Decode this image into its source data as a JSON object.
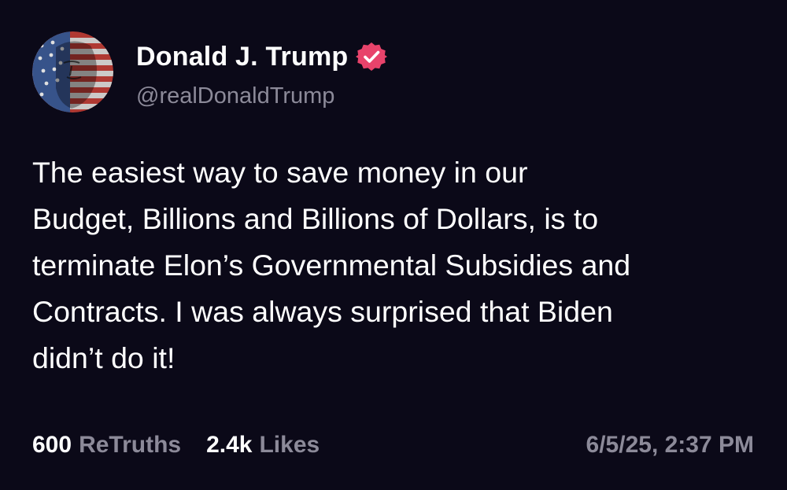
{
  "author": {
    "display_name": "Donald J. Trump",
    "handle": "@realDonaldTrump",
    "verified": true,
    "avatar_icon": "flag-portrait-avatar",
    "badge_color": "#e8436b"
  },
  "post": {
    "lines": [
      "The easiest way to save money in our",
      "Budget, Billions and Billions of Dollars, is to",
      "terminate Elon’s Governmental Subsidies and",
      "Contracts. I was always surprised that Biden",
      "didn’t do it!"
    ]
  },
  "stats": {
    "retruths_count": "600",
    "retruths_label": "ReTruths",
    "likes_count": "2.4k",
    "likes_label": "Likes"
  },
  "timestamp": "6/5/25, 2:37 PM",
  "colors": {
    "background": "#0b0918",
    "primary_text": "#ffffff",
    "secondary_text": "#8c8a99",
    "accent_badge": "#e8436b"
  }
}
